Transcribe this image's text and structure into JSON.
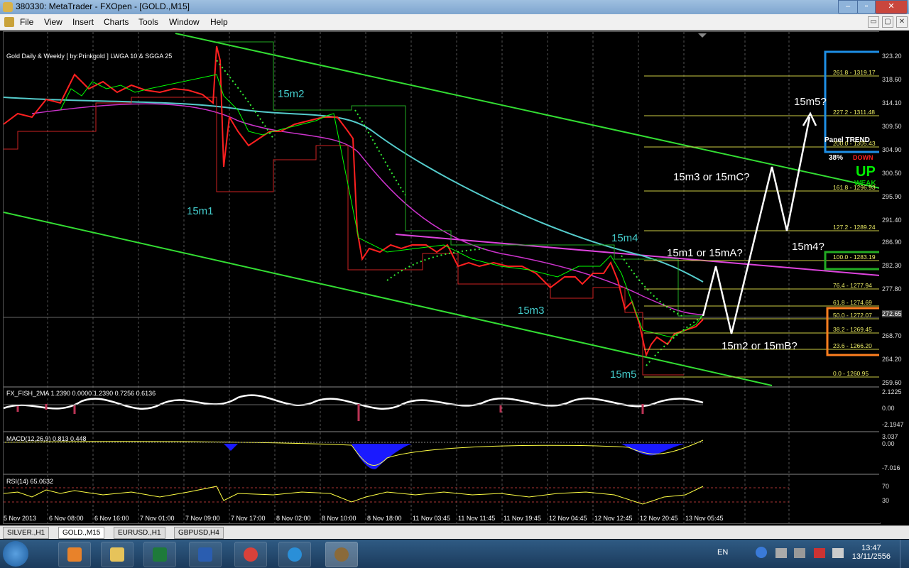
{
  "window": {
    "title": "380330: MetaTrader - FXOpen - [GOLD.,M15]",
    "min": "–",
    "max": "▫",
    "close": "✕"
  },
  "menu": [
    "File",
    "View",
    "Insert",
    "Charts",
    "Tools",
    "Window",
    "Help"
  ],
  "chart": {
    "indicator_label": "Gold Daily & Weekly [ by:Prinkgold ]  LWGA 10  &  SGGA 25",
    "fish_label": "FX_FISH_2MA  1.2390  0.0000  1.2390  0.7256  0.6136",
    "macd_label": "MACD(12,26,9)  0.813  0.448",
    "rsi_label": "RSI(14)  65.0632",
    "wave_labels": [
      "15m1",
      "15m2",
      "15m3",
      "15m4",
      "15m5"
    ],
    "scenario_labels": [
      "15m3 or 15mC?",
      "15m1 or 15mA?",
      "15m2 or 15mB?",
      "15m4?",
      "15m5?"
    ],
    "fib_levels": [
      "261.8 - 1319.17",
      "227.2 - 1311.48",
      "200.0 - 1305.43",
      "161.8 - 1296.93",
      "127.2 - 1289.24",
      "100.0 - 1283.19",
      "76.4 - 1277.94",
      "61.8 - 1274.69",
      "50.0 - 1272.07",
      "38.2 - 1269.45",
      "23.6 - 1266.20",
      "0.0 - 1260.95"
    ],
    "panel": {
      "title": "Panel  TREND",
      "pct": "38%",
      "down": "DOWN",
      "up": "UP",
      "weak": "WEAK"
    },
    "price_levels": [
      "323.20",
      "318.60",
      "314.10",
      "309.50",
      "304.90",
      "300.50",
      "295.90",
      "291.40",
      "286.90",
      "282.30",
      "277.80",
      "272.65",
      "268.70",
      "264.20",
      "259.60"
    ],
    "fish_levels": [
      "2.1225",
      "0.00",
      "-2.1947"
    ],
    "macd_levels": [
      "3.037",
      "0.00",
      "-7.016"
    ],
    "rsi_levels": [
      "70",
      "30"
    ],
    "time_labels": [
      "5 Nov 2013",
      "6 Nov 08:00",
      "6 Nov 16:00",
      "7 Nov 01:00",
      "7 Nov 09:00",
      "7 Nov 17:00",
      "8 Nov 02:00",
      "8 Nov 10:00",
      "8 Nov 18:00",
      "11 Nov 03:45",
      "11 Nov 11:45",
      "11 Nov 19:45",
      "12 Nov 04:45",
      "12 Nov 12:45",
      "12 Nov 20:45",
      "13 Nov 05:45"
    ],
    "colors": {
      "bull": "#00ff00",
      "bear": "#ff0000",
      "channel": "#33dd33",
      "ma_cyan": "#55cccc",
      "ma_magenta": "#dd44dd",
      "fib": "#cccc44",
      "blue_box": "#1e8fe6",
      "green_box": "#22aa22",
      "orange_box": "#ff7f1f"
    }
  },
  "tabs": [
    "SILVER.,H1",
    "GOLD.,M15",
    "EURUSD.,H1",
    "GBPUSD,H4"
  ],
  "taskbar": {
    "lang": "EN",
    "time": "13:47",
    "date": "13/11/2556"
  }
}
